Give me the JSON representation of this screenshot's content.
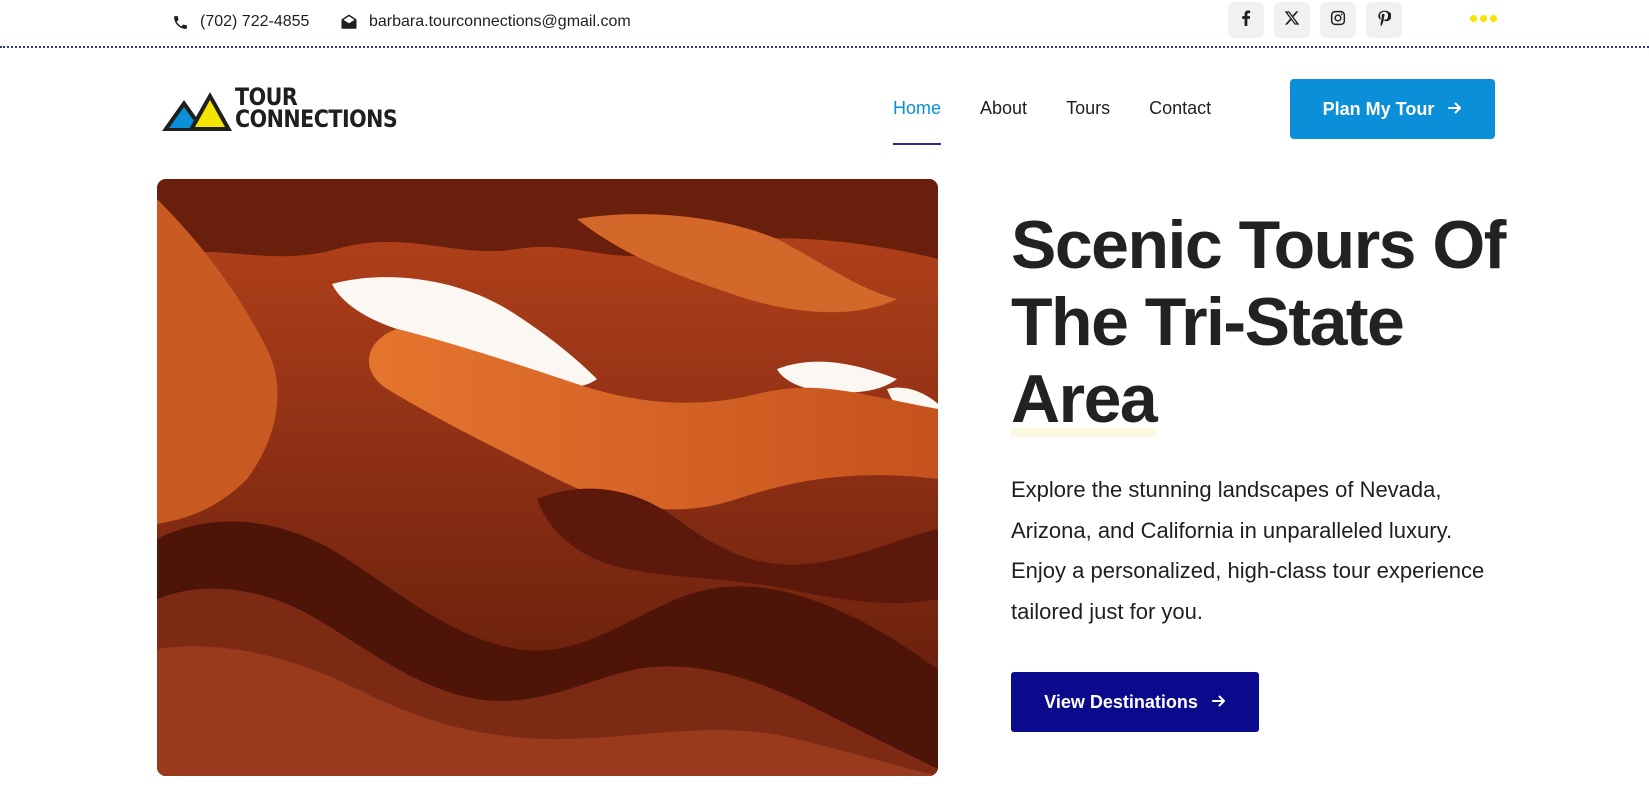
{
  "topbar": {
    "phone": "(702) 722-4855",
    "email": "barbara.tourconnections@gmail.com",
    "social": [
      {
        "icon": "facebook-icon",
        "glyph": "f"
      },
      {
        "icon": "x-twitter-icon",
        "glyph": "X"
      },
      {
        "icon": "instagram-icon",
        "glyph": "ig"
      },
      {
        "icon": "pinterest-icon",
        "glyph": "P"
      }
    ]
  },
  "header": {
    "logo": {
      "line1": "TOUR",
      "line2": "CONNECTIONS"
    },
    "nav": [
      {
        "label": "Home",
        "active": true
      },
      {
        "label": "About",
        "active": false
      },
      {
        "label": "Tours",
        "active": false
      },
      {
        "label": "Contact",
        "active": false
      }
    ],
    "cta_label": "Plan My Tour"
  },
  "hero": {
    "title_part1": "Scenic Tours Of The Tri-State ",
    "title_highlight": "Area",
    "description": "Explore the stunning landscapes of Nevada, Arizona, and California in unparalleled luxury. Enjoy a personalized, high-class tour experience tailored just for you.",
    "button_label": "View Destinations"
  },
  "colors": {
    "accent_blue": "#0a8fd8",
    "navy": "#0c0a8c",
    "highlight_yellow": "#f4e400",
    "text": "#222222"
  }
}
